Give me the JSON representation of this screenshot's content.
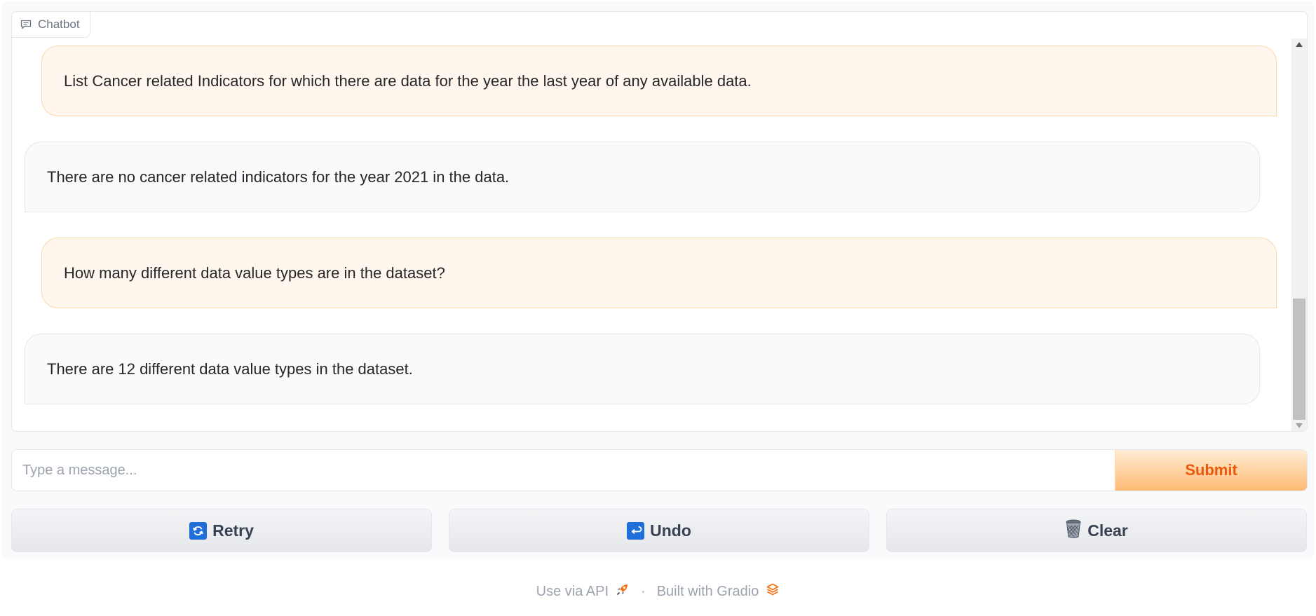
{
  "chatbot": {
    "label": "Chatbot",
    "messages": [
      {
        "role": "user",
        "text": "List Cancer related Indicators for which there are data for the year the last year of any available data."
      },
      {
        "role": "bot",
        "text": "There are no cancer related indicators for the year 2021 in the data."
      },
      {
        "role": "user",
        "text": "How many different data value types are in the dataset?"
      },
      {
        "role": "bot",
        "text": "There are 12 different data value types in the dataset."
      }
    ]
  },
  "input": {
    "placeholder": "Type a message...",
    "value": "",
    "submit_label": "Submit"
  },
  "actions": {
    "retry_label": "Retry",
    "undo_label": "Undo",
    "clear_label": "Clear",
    "retry_icon": "arrows-counterclockwise-icon",
    "undo_icon": "leftwards-arrow-with-hook-icon",
    "clear_icon": "wastebasket-icon"
  },
  "footer": {
    "api_label": "Use via API",
    "separator": "·",
    "built_with": "Built with Gradio",
    "api_icon": "rocket-icon",
    "gradio_icon": "gradio-logo-icon"
  },
  "colors": {
    "user_bubble_bg": "#fff7ed",
    "user_bubble_border": "#fed7aa",
    "bot_bubble_bg": "#f9fafb",
    "accent": "#ea580c",
    "submit_gradient_top": "#ffedd5",
    "submit_gradient_bottom": "#fdba74"
  }
}
